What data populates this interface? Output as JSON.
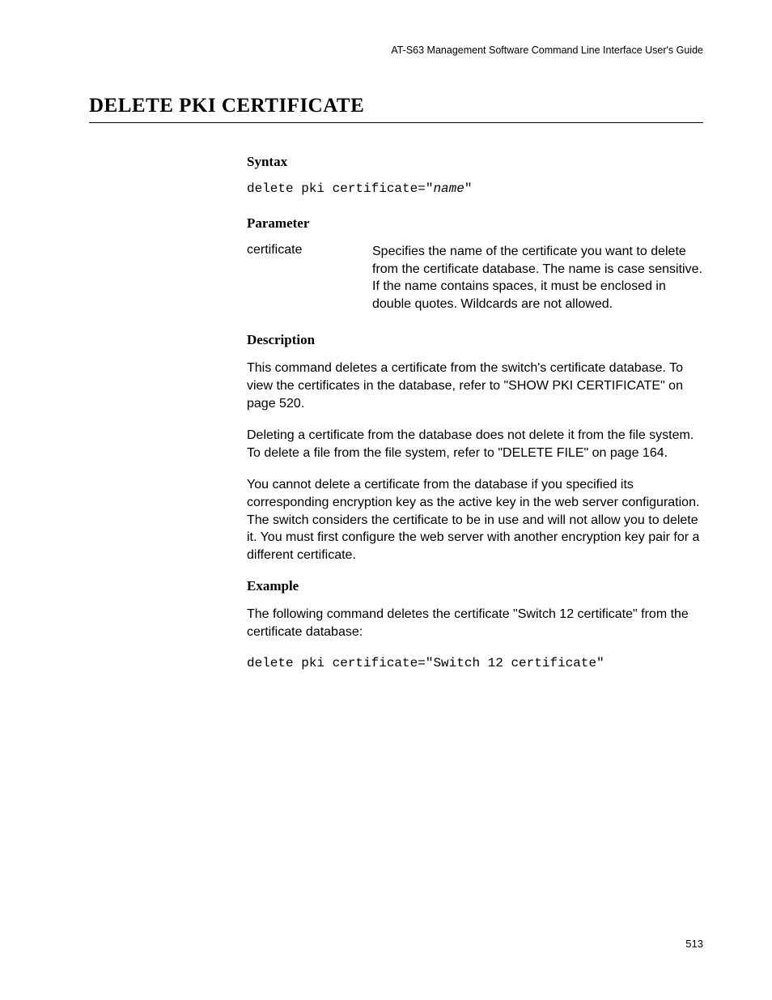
{
  "header": {
    "guide_title": "AT-S63 Management Software Command Line Interface User's Guide"
  },
  "title": "DELETE PKI CERTIFICATE",
  "sections": {
    "syntax": {
      "heading": "Syntax",
      "command_prefix": "delete pki certificate=\"",
      "command_param": "name",
      "command_suffix": "\""
    },
    "parameter": {
      "heading": "Parameter",
      "name": "certificate",
      "description": "Specifies the name of the certificate you want to delete from the certificate database. The name is case sensitive. If the name contains spaces, it must be enclosed in double quotes. Wildcards are not allowed."
    },
    "description": {
      "heading": "Description",
      "para1": "This command deletes a certificate from the switch's certificate database. To view the certificates in the database, refer to \"SHOW PKI CERTIFICATE\" on page 520.",
      "para2": "Deleting a certificate from the database does not delete it from the file system. To delete a file from the file system, refer to \"DELETE FILE\" on page 164.",
      "para3": "You cannot delete a certificate from the database if you specified its corresponding encryption key as the active key in the web server configuration. The switch considers the certificate to be in use and will not allow you to delete it. You must first configure the web server with another encryption key pair for a different certificate."
    },
    "example": {
      "heading": "Example",
      "intro": "The following command deletes the certificate \"Switch 12 certificate\" from the certificate database:",
      "command": "delete pki certificate=\"Switch 12 certificate\""
    }
  },
  "page_number": "513"
}
